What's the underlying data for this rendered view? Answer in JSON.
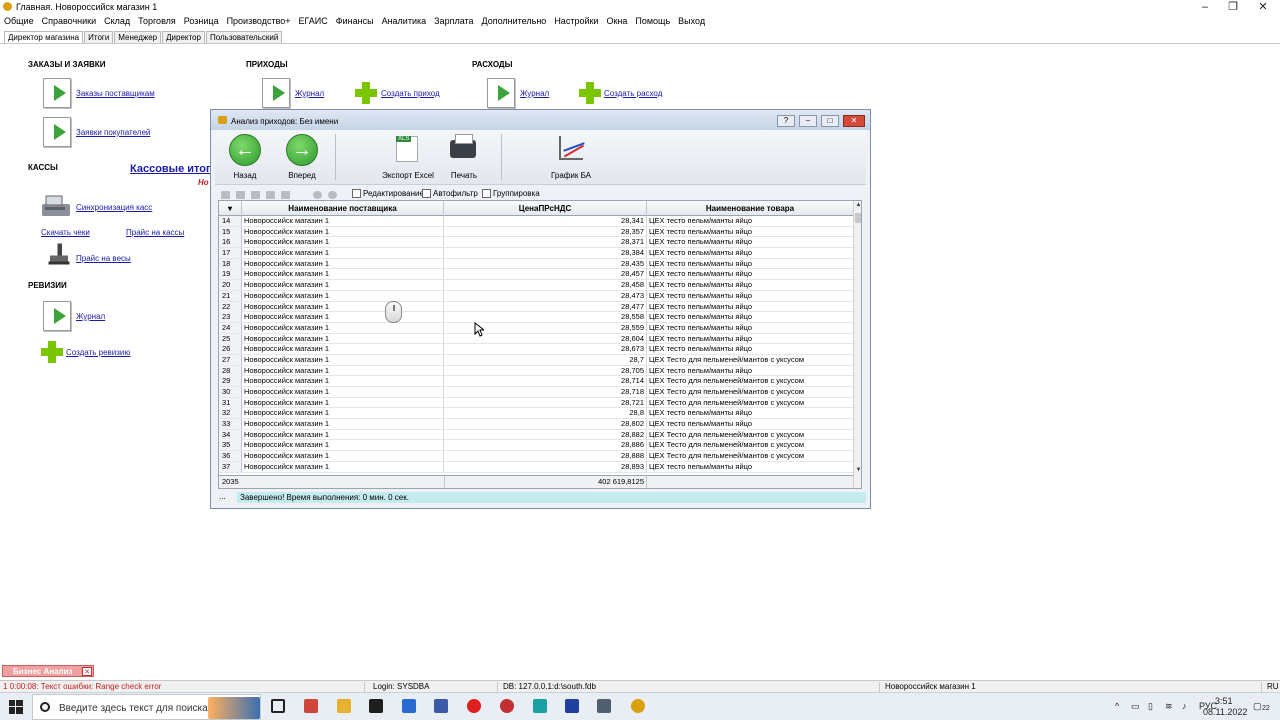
{
  "window": {
    "title": "Главная. Новороссийск магазин 1"
  },
  "menu": [
    "Общие",
    "Справочники",
    "Склад",
    "Торговля",
    "Розница",
    "Производство+",
    "ЕГАИС",
    "Финансы",
    "Аналитика",
    "Зарплата",
    "Дополнительно",
    "Настройки",
    "Окна",
    "Помощь",
    "Выход"
  ],
  "tabs": [
    "Директор магазина",
    "Итоги",
    "Менеджер",
    "Директор",
    "Пользовательский"
  ],
  "dashboard": {
    "orders_title": "ЗАКАЗЫ И ЗАЯВКИ",
    "supplier_orders": "Заказы поставщикам",
    "buyer_requests": "Заявки покупателей",
    "income_title": "ПРИХОДЫ",
    "income_journal": "Журнал",
    "create_income": "Создать приход",
    "expense_title": "РАСХОДЫ",
    "expense_journal": "Журнал",
    "create_expense": "Создать расход",
    "cash_title": "КАССЫ",
    "cash_totals": "Кассовые итоги",
    "cash_totals_sub": "Но",
    "sync_cash": "Синхронизация касс",
    "download_checks": "Скачать чеки",
    "price_cash": "Прайс на кассы",
    "price_scales": "Прайс на весы",
    "audit_title": "РЕВИЗИИ",
    "audit_journal": "Журнал",
    "create_audit": "Создать ревизию"
  },
  "dialog": {
    "title": "Анализ приходов: Без имени",
    "help_btn": "?",
    "toolbar": {
      "back": "Назад",
      "forward": "Вперед",
      "export": "Экспорт Excel",
      "print": "Печать",
      "chart": "График БА"
    },
    "filters": {
      "editing": "Редактирование",
      "autofilter": "Автофильтр",
      "grouping": "Группировка"
    },
    "columns": [
      "Наименование поставщика",
      "ЦенаПРсНДС",
      "Наименование товара"
    ],
    "rows": [
      [
        "14",
        "Новороссийск магазин 1",
        "28,341",
        "ЦЕХ тесто пельм/манты яйцо"
      ],
      [
        "15",
        "Новороссийск магазин 1",
        "28,357",
        "ЦЕХ тесто пельм/манты яйцо"
      ],
      [
        "16",
        "Новороссийск магазин 1",
        "28,371",
        "ЦЕХ тесто пельм/манты яйцо"
      ],
      [
        "17",
        "Новороссийск магазин 1",
        "28,384",
        "ЦЕХ тесто пельм/манты яйцо"
      ],
      [
        "18",
        "Новороссийск магазин 1",
        "28,435",
        "ЦЕХ тесто пельм/манты яйцо"
      ],
      [
        "19",
        "Новороссийск магазин 1",
        "28,457",
        "ЦЕХ тесто пельм/манты яйцо"
      ],
      [
        "20",
        "Новороссийск магазин 1",
        "28,458",
        "ЦЕХ тесто пельм/манты яйцо"
      ],
      [
        "21",
        "Новороссийск магазин 1",
        "28,473",
        "ЦЕХ тесто пельм/манты яйцо"
      ],
      [
        "22",
        "Новороссийск магазин 1",
        "28,477",
        "ЦЕХ тесто пельм/манты яйцо"
      ],
      [
        "23",
        "Новороссийск магазин 1",
        "28,558",
        "ЦЕХ тесто пельм/манты яйцо"
      ],
      [
        "24",
        "Новороссийск магазин 1",
        "28,559",
        "ЦЕХ тесто пельм/манты яйцо"
      ],
      [
        "25",
        "Новороссийск магазин 1",
        "28,604",
        "ЦЕХ тесто пельм/манты яйцо"
      ],
      [
        "26",
        "Новороссийск магазин 1",
        "28,673",
        "ЦЕХ тесто пельм/манты яйцо"
      ],
      [
        "27",
        "Новороссийск магазин 1",
        "28,7",
        "ЦЕХ Тесто для пельменей/мантов с уксусом"
      ],
      [
        "28",
        "Новороссийск магазин 1",
        "28,705",
        "ЦЕХ тесто пельм/манты яйцо"
      ],
      [
        "29",
        "Новороссийск магазин 1",
        "28,714",
        "ЦЕХ Тесто для пельменей/мантов с уксусом"
      ],
      [
        "30",
        "Новороссийск магазин 1",
        "28,718",
        "ЦЕХ Тесто для пельменей/мантов с уксусом"
      ],
      [
        "31",
        "Новороссийск магазин 1",
        "28,721",
        "ЦЕХ Тесто для пельменей/мантов с уксусом"
      ],
      [
        "32",
        "Новороссийск магазин 1",
        "28,8",
        "ЦЕХ тесто пельм/манты яйцо"
      ],
      [
        "33",
        "Новороссийск магазин 1",
        "28,802",
        "ЦЕХ тесто пельм/манты яйцо"
      ],
      [
        "34",
        "Новороссийск магазин 1",
        "28,882",
        "ЦЕХ Тесто для пельменей/мантов с уксусом"
      ],
      [
        "35",
        "Новороссийск магазин 1",
        "28,886",
        "ЦЕХ Тесто для пельменей/мантов с уксусом"
      ],
      [
        "36",
        "Новороссийск магазин 1",
        "28,888",
        "ЦЕХ Тесто для пельменей/мантов с уксусом"
      ],
      [
        "37",
        "Новороссийск магазин 1",
        "28,893",
        "ЦЕХ тесто пельм/манты яйцо"
      ]
    ],
    "footer_count": "2035",
    "footer_sum": "402 619,8125",
    "status_dots": "...",
    "status": "Завершено! Время выполнения: 0 мин. 0 сек."
  },
  "bottom_tab": "Бизнес Анализ",
  "statusbar": {
    "error": "1  0:00:08: Текст ошибки: Range check error",
    "login": "Login: SYSDBA",
    "db": "DB: 127.0.0.1:d:\\south.fdb",
    "store": "Новороссийск магазин 1",
    "lang": "RU"
  },
  "taskbar": {
    "search_placeholder": "Введите здесь текст для поиска",
    "lang": "РУС",
    "time": "3:51",
    "date": "08.11.2022",
    "notif": "22"
  },
  "colors": {
    "accent": "#1a1aaa",
    "status_bg": "#c4ecf0",
    "bottom_tab": "#f0a0a0"
  }
}
